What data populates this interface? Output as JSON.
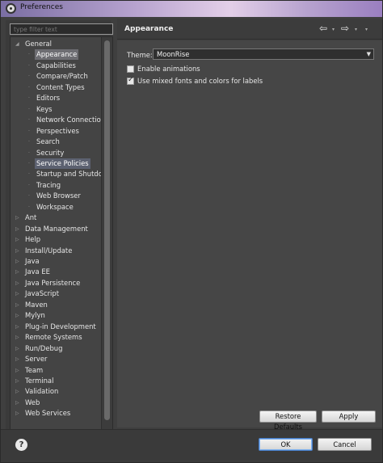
{
  "window": {
    "title": "Preferences"
  },
  "filter": {
    "placeholder": "type filter text"
  },
  "tree": {
    "items": [
      {
        "label": "General",
        "level": 0,
        "expanded": true
      },
      {
        "label": "Appearance",
        "level": 1,
        "selected": true
      },
      {
        "label": "Capabilities",
        "level": 1
      },
      {
        "label": "Compare/Patch",
        "level": 1
      },
      {
        "label": "Content Types",
        "level": 1
      },
      {
        "label": "Editors",
        "level": 1
      },
      {
        "label": "Keys",
        "level": 1
      },
      {
        "label": "Network Connections",
        "level": 1
      },
      {
        "label": "Perspectives",
        "level": 1
      },
      {
        "label": "Search",
        "level": 1
      },
      {
        "label": "Security",
        "level": 1
      },
      {
        "label": "Service Policies",
        "level": 1,
        "highlight": true
      },
      {
        "label": "Startup and Shutdown",
        "level": 1
      },
      {
        "label": "Tracing",
        "level": 1
      },
      {
        "label": "Web Browser",
        "level": 1
      },
      {
        "label": "Workspace",
        "level": 1
      },
      {
        "label": "Ant",
        "level": 0
      },
      {
        "label": "Data Management",
        "level": 0
      },
      {
        "label": "Help",
        "level": 0
      },
      {
        "label": "Install/Update",
        "level": 0
      },
      {
        "label": "Java",
        "level": 0
      },
      {
        "label": "Java EE",
        "level": 0
      },
      {
        "label": "Java Persistence",
        "level": 0
      },
      {
        "label": "JavaScript",
        "level": 0
      },
      {
        "label": "Maven",
        "level": 0
      },
      {
        "label": "Mylyn",
        "level": 0
      },
      {
        "label": "Plug-in Development",
        "level": 0
      },
      {
        "label": "Remote Systems",
        "level": 0
      },
      {
        "label": "Run/Debug",
        "level": 0
      },
      {
        "label": "Server",
        "level": 0
      },
      {
        "label": "Team",
        "level": 0
      },
      {
        "label": "Terminal",
        "level": 0
      },
      {
        "label": "Validation",
        "level": 0
      },
      {
        "label": "Web",
        "level": 0
      },
      {
        "label": "Web Services",
        "level": 0
      }
    ]
  },
  "page": {
    "title": "Appearance",
    "theme_label": "Theme:",
    "theme_value": "MoonRise",
    "enable_animations": {
      "label": "Enable animations",
      "checked": false
    },
    "mixed_fonts": {
      "label": "Use mixed fonts and colors for labels",
      "checked": true
    },
    "restore_defaults": "Restore Defaults",
    "apply": "Apply"
  },
  "nav": {
    "back": "⇦",
    "forward": "⇨",
    "menu": "▾"
  },
  "footer": {
    "help": "?",
    "ok": "OK",
    "cancel": "Cancel"
  }
}
